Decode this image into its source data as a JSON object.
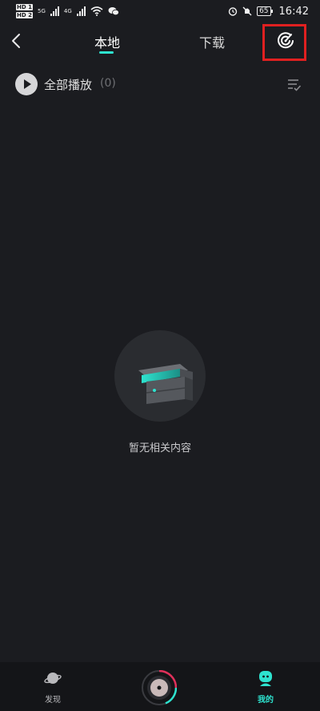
{
  "status_bar": {
    "hd_top": "HD 1",
    "hd_bottom": "HD 2",
    "net_1": "5G",
    "net_2": "4G",
    "battery": "65",
    "time": "16:42"
  },
  "header": {
    "tabs": [
      {
        "label": "本地",
        "active": true
      },
      {
        "label": "下载",
        "active": false
      }
    ]
  },
  "play_all": {
    "label": "全部播放",
    "count": "(0)"
  },
  "empty_state": {
    "text": "暂无相关内容"
  },
  "bottom_nav": {
    "items": [
      {
        "label": "发现",
        "icon": "planet-icon",
        "active": false
      },
      {
        "label": "",
        "icon": "record-disc-icon",
        "active": false
      },
      {
        "label": "我的",
        "icon": "user-icon",
        "active": true
      }
    ]
  },
  "colors": {
    "background": "#1b1c20",
    "accent": "#2ee3cf",
    "highlight_box": "#e02020",
    "nav_background": "#141518"
  }
}
